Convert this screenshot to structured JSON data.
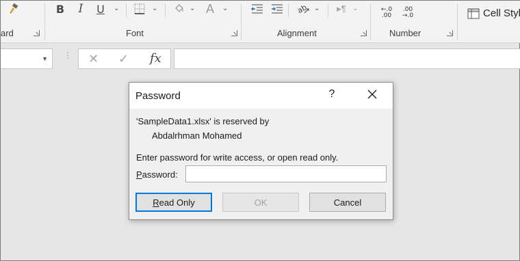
{
  "ribbon": {
    "clipboard_label": "ard",
    "font_label": "Font",
    "alignment_label": "Alignment",
    "number_label": "Number",
    "cell_styles_label": "Cell Styl",
    "bold_glyph": "B",
    "italic_glyph": "I",
    "underline_glyph": "U",
    "font_color_glyph": "A",
    "decrease_decimal_top": "←.0",
    "decrease_decimal_bottom": ".00",
    "increase_decimal_top": ".00",
    "increase_decimal_bottom": "→.0"
  },
  "formula_bar": {
    "cancel_glyph": "✕",
    "enter_glyph": "✓",
    "fx_label": "fx",
    "formula_value": ""
  },
  "dialog": {
    "title": "Password",
    "help_glyph": "?",
    "reserved_line": "'SampleData1.xlsx' is reserved by",
    "owner_name": "Abdalrhman Mohamed",
    "instruction": "Enter password for write access, or open read only.",
    "password_label_prefix": "P",
    "password_label_rest": "assword:",
    "password_value": "",
    "read_only_prefix": "R",
    "read_only_rest": "ead Only",
    "ok_label": "OK",
    "cancel_label": "Cancel"
  }
}
